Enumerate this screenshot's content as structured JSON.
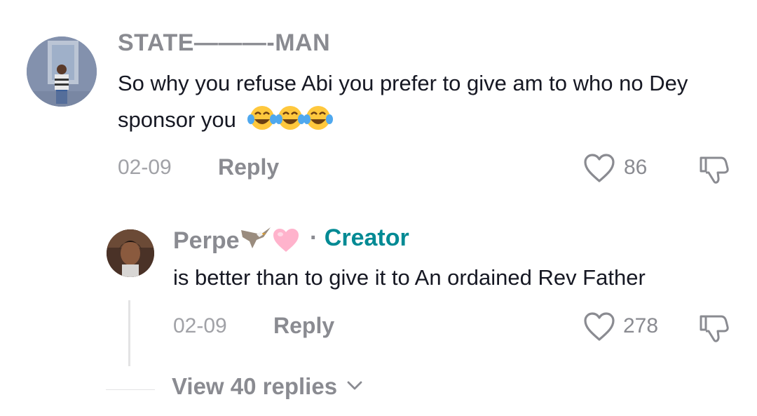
{
  "comment": {
    "username": "STATE———-MAN",
    "text": "So why you refuse Abi you prefer to give am to who no Dey sponsor you",
    "emojis": [
      "face-with-tears-of-joy",
      "face-with-tears-of-joy",
      "face-with-tears-of-joy"
    ],
    "date": "02-09",
    "reply_label": "Reply",
    "like_count": "86"
  },
  "reply": {
    "username": "Perpe",
    "username_decor": [
      "eagle-emoji",
      "pink-heart-emoji"
    ],
    "separator": "·",
    "badge": "Creator",
    "text": "is better than to give it to An ordained Rev Father",
    "date": "02-09",
    "reply_label": "Reply",
    "like_count": "278"
  },
  "view_replies": {
    "label": "View 40 replies"
  },
  "colors": {
    "muted_text": "#8a8b91",
    "creator_badge": "#008a94",
    "body_text": "#161823"
  }
}
